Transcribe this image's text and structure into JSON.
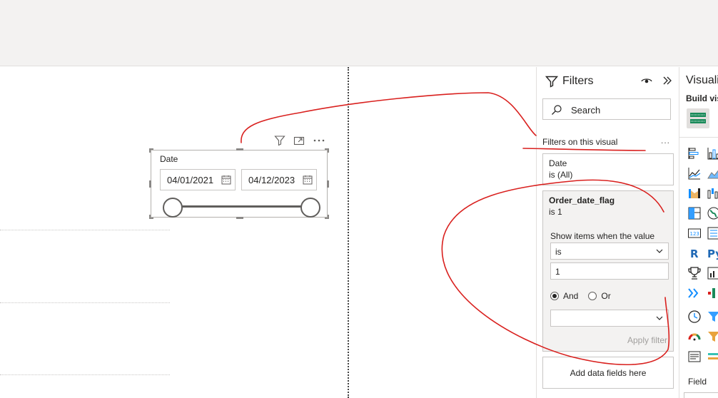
{
  "slicer": {
    "title": "Date",
    "start_date": "04/01/2021",
    "end_date": "04/12/2023"
  },
  "filters_pane": {
    "title": "Filters",
    "search_placeholder": "Search",
    "section_label": "Filters on this visual",
    "more": "...",
    "date_card": {
      "name": "Date",
      "summary": "is (All)"
    },
    "flag_card": {
      "name": "Order_date_flag",
      "summary": "is 1",
      "show_items_label": "Show items when the value",
      "operator": "is",
      "value": "1",
      "and_label": "And",
      "or_label": "Or",
      "logic_selected": "And",
      "second_operator": "",
      "apply_label": "Apply filter"
    },
    "add_fields": "Add data fields here"
  },
  "viz_pane": {
    "title": "Visualizations",
    "build_label": "Build visual",
    "field_label": "Field",
    "accent": "#118dff"
  },
  "colors": {
    "annotation_ink": "#d9201e",
    "ribbon": "#f3f2f1",
    "border": "#c8c6c4"
  }
}
